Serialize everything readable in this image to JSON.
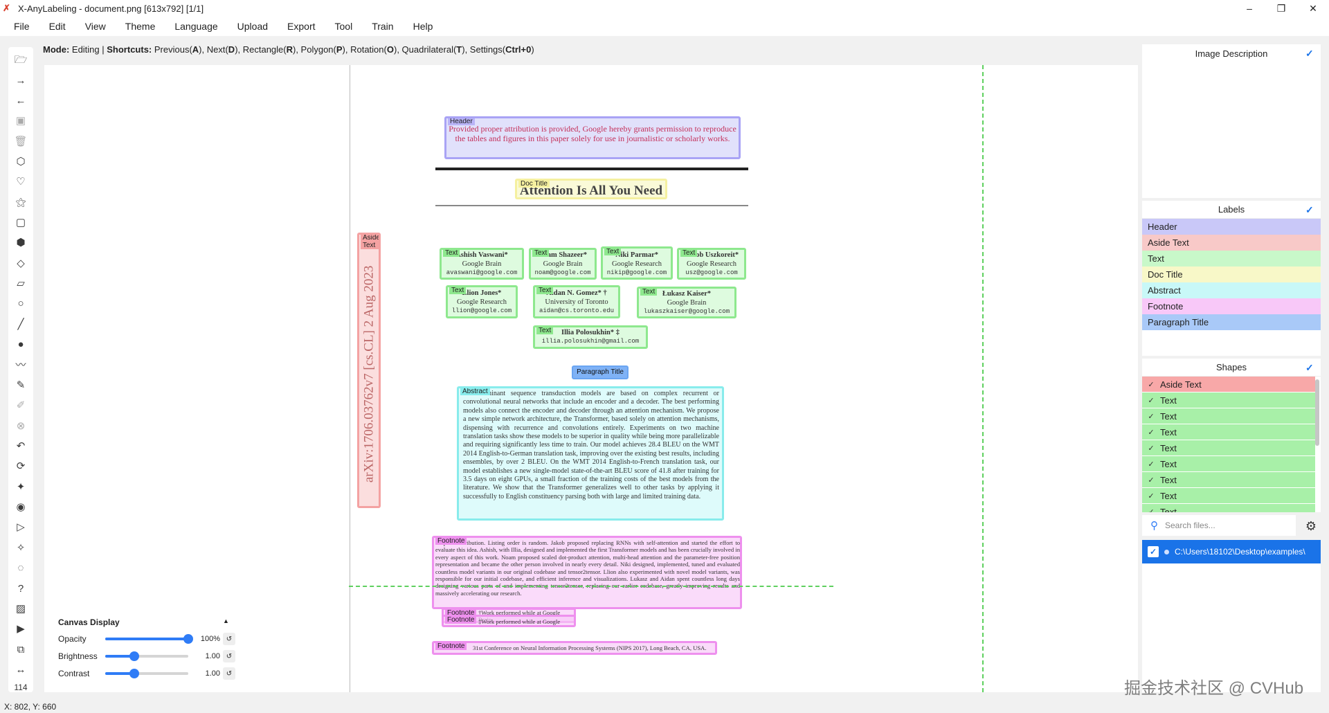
{
  "window": {
    "title": "X-AnyLabeling - document.png [613x792] [1/1]",
    "controls": {
      "minimize": "–",
      "maximize": "❐",
      "close": "✕"
    }
  },
  "menu": [
    "File",
    "Edit",
    "View",
    "Theme",
    "Language",
    "Upload",
    "Export",
    "Tool",
    "Train",
    "Help"
  ],
  "modebar": {
    "mode_label": "Mode:",
    "mode_value": " Editing | ",
    "shortcuts_label": "Shortcuts:",
    "p1": " Previous(",
    "k1": "A",
    "p2": "), Next(",
    "k2": "D",
    "p3": "), Rectangle(",
    "k3": "R",
    "p4": "), Polygon(",
    "k4": "P",
    "p5": "), Rotation(",
    "k5": "O",
    "p6": "), Quadrilateral(",
    "k6": "T",
    "p7": "), Settings(",
    "k7": "Ctrl+0",
    "p8": ")"
  },
  "toolbar": {
    "icons": [
      "open-folder-icon",
      "next-arrow-icon",
      "prev-arrow-icon",
      "save-icon",
      "delete-icon",
      "polygon-icon",
      "heart-icon",
      "magic-wand-icon",
      "rectangle-icon",
      "cube-icon",
      "diamond-icon",
      "rotation-icon",
      "circle-icon",
      "line-icon",
      "point-icon",
      "linestrip-icon",
      "brush-icon",
      "edit-icon",
      "eraser-icon",
      "undo-icon",
      "loop-icon",
      "ai-icon",
      "eye-icon",
      "play-icon",
      "tag-icon",
      "chat-icon",
      "help-icon",
      "image-icon",
      "video-icon",
      "copy-icon",
      "fit-width-icon"
    ],
    "zoom": "114"
  },
  "document": {
    "header_text": "Provided proper attribution is provided, Google hereby grants permission to reproduce the tables and figures in this paper solely for use in journalistic or scholarly works.",
    "title": "Attention Is All You Need",
    "aside": "arXiv:1706.03762v7  [cs.CL]  2 Aug 2023",
    "authors": [
      {
        "name": "Ashish Vaswani*",
        "org": "Google Brain",
        "email": "avaswani@google.com"
      },
      {
        "name": "Noam Shazeer*",
        "org": "Google Brain",
        "email": "noam@google.com"
      },
      {
        "name": "Niki Parmar*",
        "org": "Google Research",
        "email": "nikip@google.com"
      },
      {
        "name": "Jakob Uszkoreit*",
        "org": "Google Research",
        "email": "usz@google.com"
      },
      {
        "name": "Llion Jones*",
        "org": "Google Research",
        "email": "llion@google.com"
      },
      {
        "name": "Aidan N. Gomez* †",
        "org": "University of Toronto",
        "email": "aidan@cs.toronto.edu"
      },
      {
        "name": "Łukasz Kaiser*",
        "org": "Google Brain",
        "email": "lukaszkaiser@google.com"
      },
      {
        "name": "Illia Polosukhin* ‡",
        "org": "",
        "email": "illia.polosukhin@gmail.com"
      }
    ],
    "paragraph_title": "Abstract",
    "abstract": "The dominant sequence transduction models are based on complex recurrent or convolutional neural networks that include an encoder and a decoder. The best performing models also connect the encoder and decoder through an attention mechanism. We propose a new simple network architecture, the Transformer, based solely on attention mechanisms, dispensing with recurrence and convolutions entirely. Experiments on two machine translation tasks show these models to be superior in quality while being more parallelizable and requiring significantly less time to train. Our model achieves 28.4 BLEU on the WMT 2014 English-to-German translation task, improving over the existing best results, including ensembles, by over 2 BLEU. On the WMT 2014 English-to-French translation task, our model establishes a new single-model state-of-the-art BLEU score of 41.8 after training for 3.5 days on eight GPUs, a small fraction of the training costs of the best models from the literature. We show that the Transformer generalizes well to other tasks by applying it successfully to English constituency parsing both with large and limited training data.",
    "footnote1": "*Equal contribution. Listing order is random. Jakob proposed replacing RNNs with self-attention and started the effort to evaluate this idea. Ashish, with Illia, designed and implemented the first Transformer models and has been crucially involved in every aspect of this work. Noam proposed scaled dot-product attention, multi-head attention and the parameter-free position representation and became the other person involved in nearly every detail. Niki designed, implemented, tuned and evaluated countless model variants in our original codebase and tensor2tensor. Llion also experimented with novel model variants, was responsible for our initial codebase, and efficient inference and visualizations. Lukasz and Aidan spent countless long days designing various parts of and implementing tensor2tensor, replacing our earlier codebase, greatly improving results and massively accelerating our research.",
    "footnote2a": "†Work performed while at Google Brain.",
    "footnote2b": "‡Work performed while at Google Research.",
    "footnote3": "31st Conference on Neural Information Processing Systems (NIPS 2017), Long Beach, CA, USA."
  },
  "annotations": {
    "header": "Header",
    "doc_title": "Doc Title",
    "aside": "Aside Text",
    "text": "Text",
    "paragraph_title": "Paragraph Title",
    "abstract": "Abstract",
    "footnote": "Footnote"
  },
  "canvas_display": {
    "title": "Canvas Display",
    "caret": "▲",
    "reset_icon": "↺",
    "opacity_label": "Opacity",
    "opacity_value": "100%",
    "opacity_level": 1.0,
    "brightness_label": "Brightness",
    "brightness_value": "1.00",
    "brightness_level": 0.35,
    "contrast_label": "Contrast",
    "contrast_value": "1.00",
    "contrast_level": 0.35
  },
  "image_description": {
    "title": "Image Description",
    "check": "✓"
  },
  "labels_panel": {
    "title": "Labels",
    "check": "✓",
    "items": [
      {
        "name": "Header",
        "color": "#c9c8f8"
      },
      {
        "name": "Aside Text",
        "color": "#f8c9c8"
      },
      {
        "name": "Text",
        "color": "#c8f8c9"
      },
      {
        "name": "Doc Title",
        "color": "#f8f8c8"
      },
      {
        "name": "Abstract",
        "color": "#c8f8f8"
      },
      {
        "name": "Footnote",
        "color": "#f8c8f8"
      },
      {
        "name": "Paragraph Title",
        "color": "#a9c9f8"
      }
    ]
  },
  "shapes_panel": {
    "title": "Shapes",
    "check": "✓",
    "item_check": "✓",
    "items": [
      {
        "name": "Aside Text",
        "color": "#f8a8a8"
      },
      {
        "name": "Text",
        "color": "#a8f0a8"
      },
      {
        "name": "Text",
        "color": "#a8f0a8"
      },
      {
        "name": "Text",
        "color": "#a8f0a8"
      },
      {
        "name": "Text",
        "color": "#a8f0a8"
      },
      {
        "name": "Text",
        "color": "#a8f0a8"
      },
      {
        "name": "Text",
        "color": "#a8f0a8"
      },
      {
        "name": "Text",
        "color": "#a8f0a8"
      },
      {
        "name": "Text",
        "color": "#a8f0a8"
      }
    ]
  },
  "file_search": {
    "placeholder": "Search files...",
    "icon": "⚲",
    "settings_icon": "⚙"
  },
  "files": [
    {
      "path": "C:\\Users\\18102\\Desktop\\examples\\",
      "checked": "✓"
    }
  ],
  "status": {
    "coords": "X: 802, Y: 660"
  },
  "watermark": "掘金技术社区 @ CVHub",
  "colors": {
    "accent": "#2f7cf6",
    "selection": "#1a73e8"
  }
}
